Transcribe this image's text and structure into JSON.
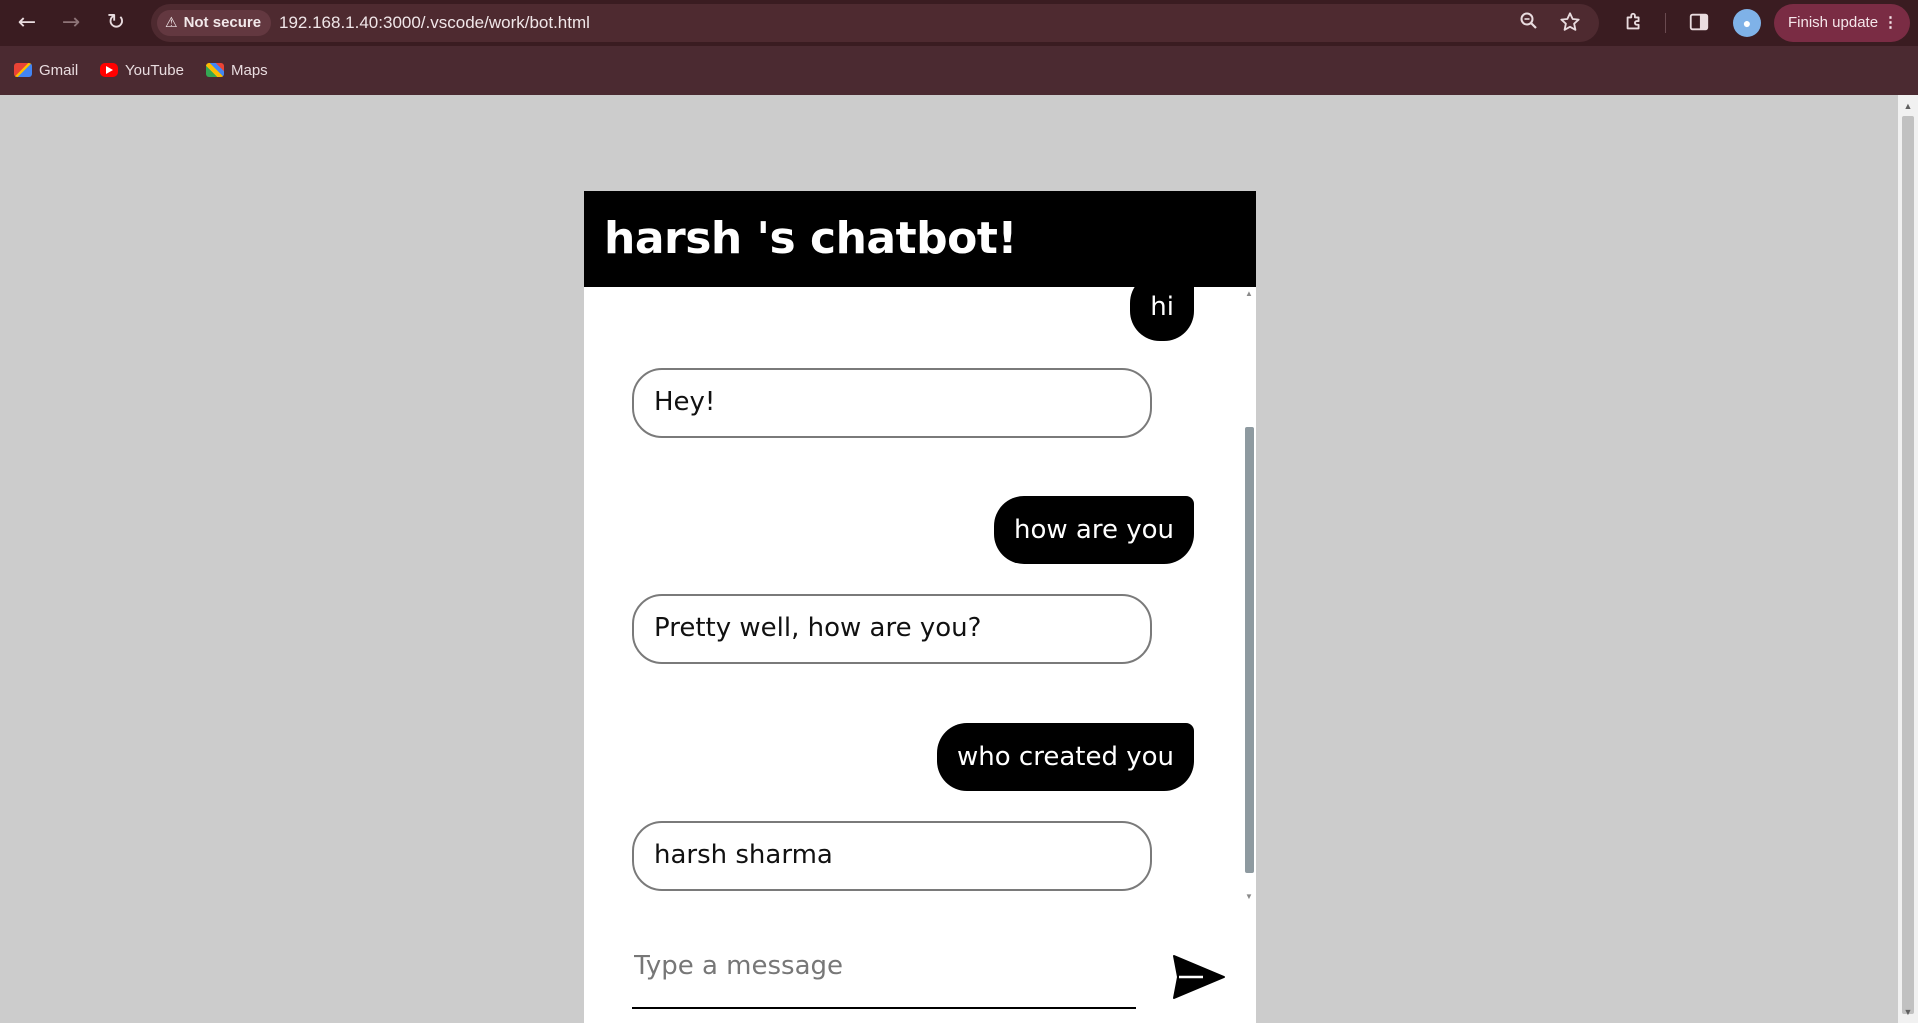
{
  "browser": {
    "nav": {
      "back_icon": "←",
      "forward_icon": "→",
      "reload_icon": "↻"
    },
    "security_chip": {
      "icon": "⚠",
      "label": "Not secure"
    },
    "url": "192.168.1.40:3000/.vscode/work/bot.html",
    "update_button": {
      "label": "Finish update",
      "menu": "⋮"
    },
    "bookmarks": [
      {
        "label": "Gmail",
        "color": "#ea4335"
      },
      {
        "label": "YouTube",
        "color": "#ff0000"
      },
      {
        "label": "Maps",
        "color": "#34a853"
      }
    ]
  },
  "chat": {
    "title": "harsh 's chatbot!",
    "messages": [
      {
        "sender": "user",
        "text": "hi"
      },
      {
        "sender": "bot",
        "text": "Hey!"
      },
      {
        "sender": "user",
        "text": "how are you"
      },
      {
        "sender": "bot",
        "text": "Pretty well, how are you?"
      },
      {
        "sender": "user",
        "text": "who created you"
      },
      {
        "sender": "bot",
        "text": "harsh sharma"
      }
    ],
    "input": {
      "placeholder": "Type a message",
      "value": ""
    }
  }
}
